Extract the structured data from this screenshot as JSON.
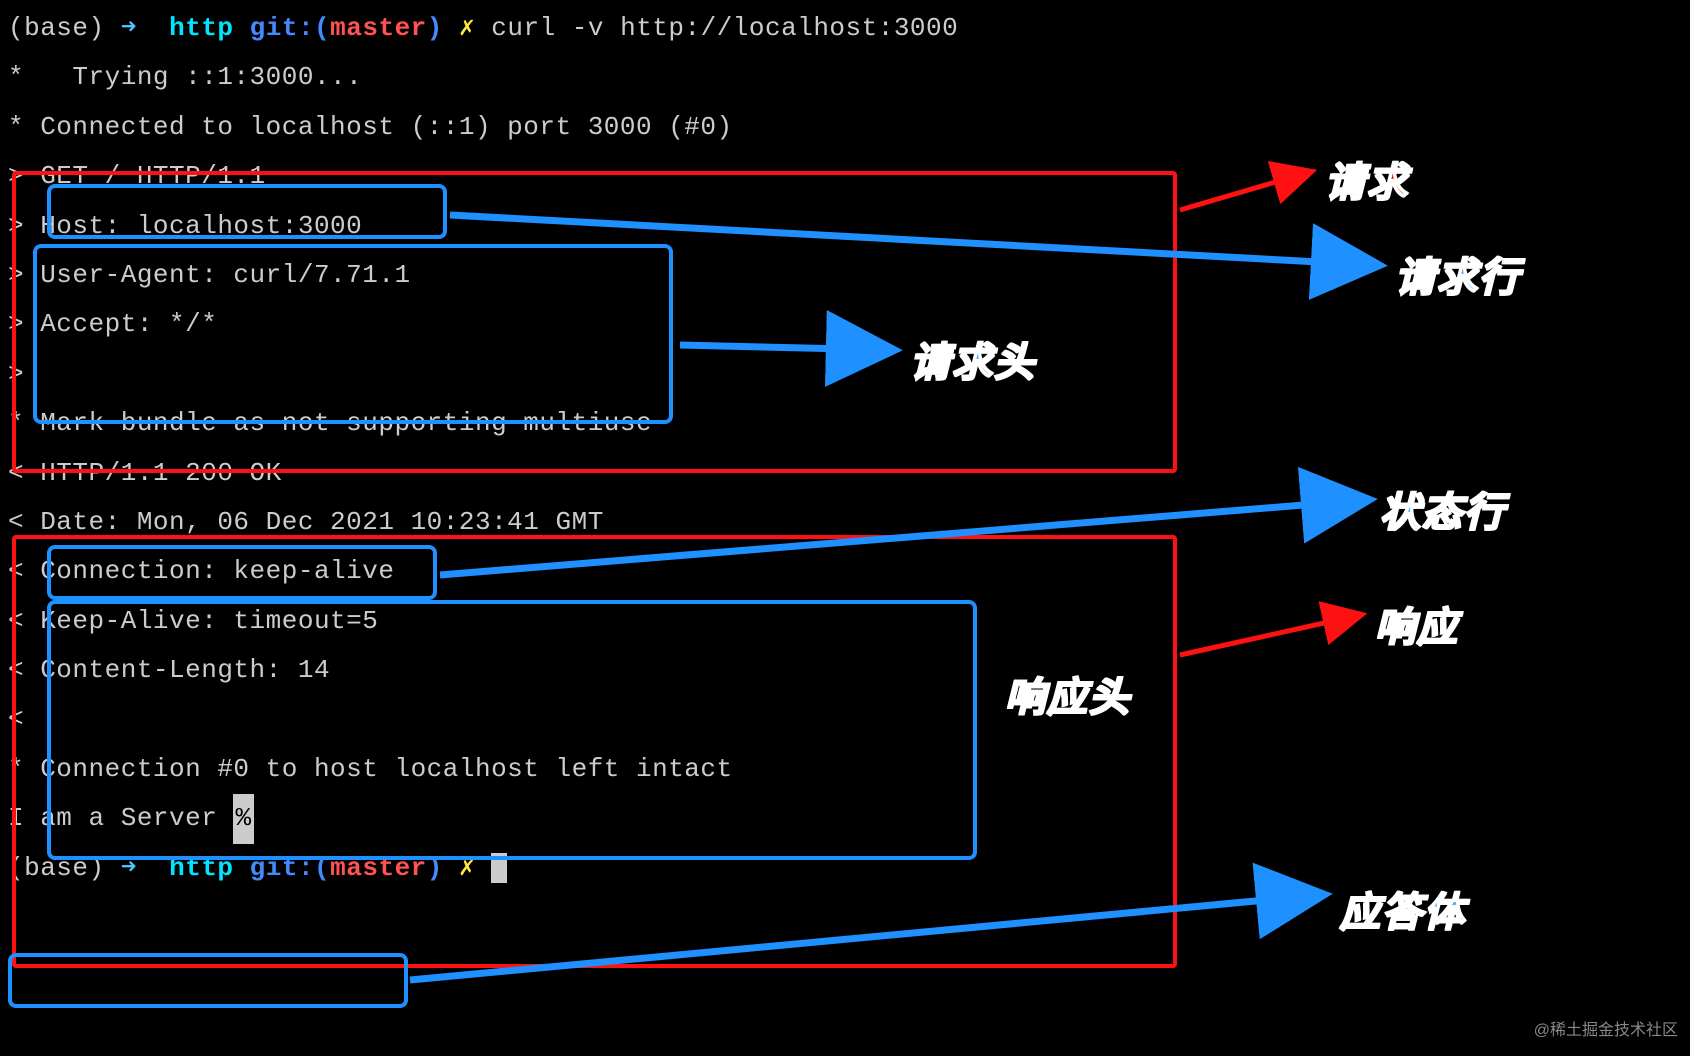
{
  "prompt": {
    "base": "(base)",
    "arrow": "➜",
    "dir": "http",
    "git_label": "git:(",
    "branch": "master",
    "git_close": ")",
    "x": "✗",
    "command": "curl -v http://localhost:3000"
  },
  "lines": {
    "trying": "*   Trying ::1:3000...",
    "connected": "* Connected to localhost (::1) port 3000 (#0)",
    "req_line": "> GET / HTTP/1.1",
    "req_h1": "> Host: localhost:3000",
    "req_h2": "> User-Agent: curl/7.71.1",
    "req_h3": "> Accept: */*",
    "req_empty": ">",
    "mark": "* Mark bundle as not supporting multiuse",
    "status": "< HTTP/1.1 200 OK",
    "res_h1": "< Date: Mon, 06 Dec 2021 10:23:41 GMT",
    "res_h2": "< Connection: keep-alive",
    "res_h3": "< Keep-Alive: timeout=5",
    "res_h4": "< Content-Length: 14",
    "res_empty": "<",
    "left_intact": "* Connection #0 to host localhost left intact",
    "body": "I am a Server "
  },
  "annotations": {
    "request": "请求",
    "request_line": "请求行",
    "request_headers": "请求头",
    "status_line": "状态行",
    "response": "响应",
    "response_headers": "响应头",
    "response_body": "应答体"
  },
  "watermark": "@稀土掘金技术社区"
}
